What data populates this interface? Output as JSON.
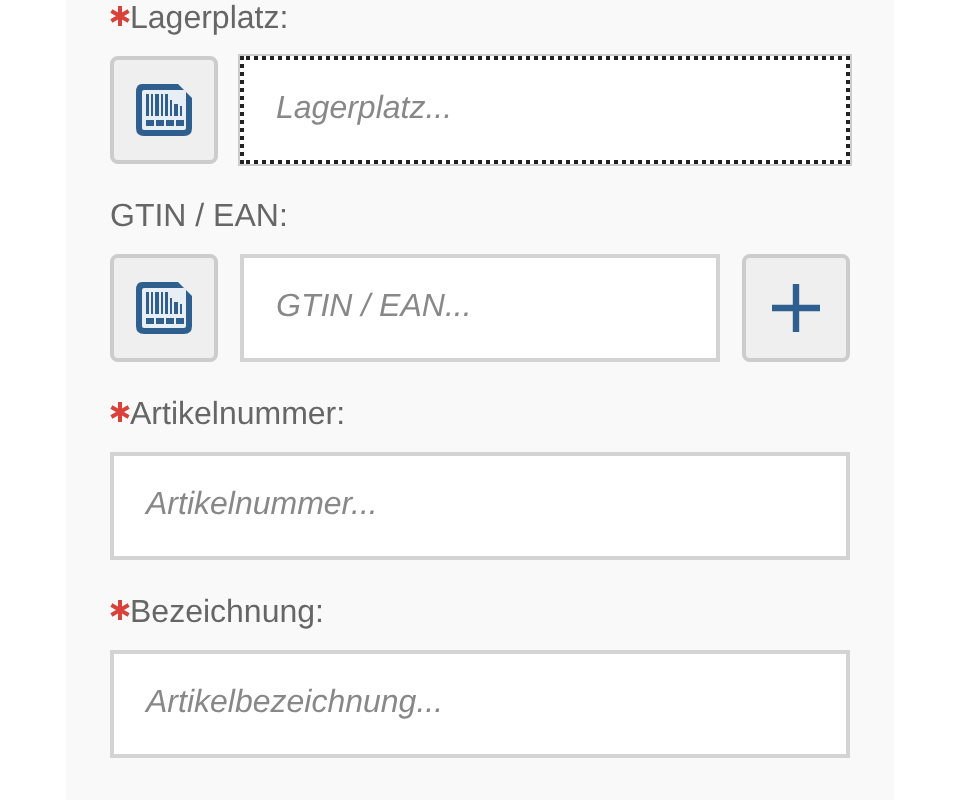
{
  "fields": [
    {
      "kind": "scan",
      "label": "Lagerplatz:",
      "required": true,
      "placeholder": "Lagerplatz...",
      "focused": true,
      "add_button": false
    },
    {
      "kind": "scan",
      "label": "GTIN / EAN:",
      "required": false,
      "placeholder": "GTIN / EAN...",
      "focused": false,
      "add_button": true
    },
    {
      "kind": "text",
      "label": "Artikelnummer:",
      "required": true,
      "placeholder": "Artikelnummer...",
      "focused": false,
      "add_button": false
    },
    {
      "kind": "text",
      "label": "Bezeichnung:",
      "required": true,
      "placeholder": "Artikelbezeichnung...",
      "focused": false,
      "add_button": false
    }
  ]
}
